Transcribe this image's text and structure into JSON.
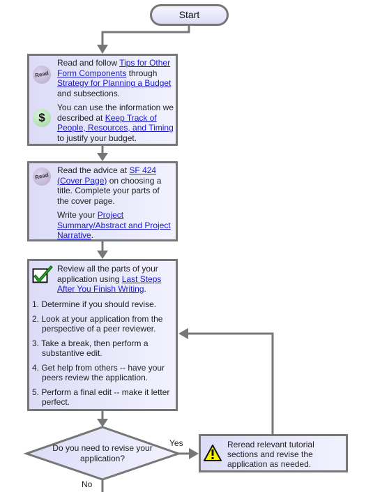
{
  "start": {
    "label": "Start"
  },
  "box1": {
    "read_icon": "Read",
    "p1": {
      "pre": "Read and follow ",
      "link1": "Tips for Other Form Components",
      "mid": " through ",
      "link2": "Strategy for Planning a Budget",
      "post": " and subsections."
    },
    "dollar_icon": "$",
    "p2": {
      "pre": "You can use the information we described at ",
      "link": "Keep Track of People, Resources, and Timing",
      "post": " to justify your budget."
    }
  },
  "box2": {
    "read_icon": "Read",
    "p1": {
      "pre": "Read the advice at ",
      "link": "SF 424 (Cover Page)",
      "post": " on choosing a title. Complete your parts of the cover page."
    },
    "p2": {
      "pre": "Write your ",
      "link": "Project Summary/Abstract and Project Narrative",
      "post": "."
    }
  },
  "box3": {
    "icon": "checkmark-icon",
    "intro": {
      "pre": "Review all the parts of your application using ",
      "link": "Last Steps After You Finish Writing",
      "post": "."
    },
    "steps": [
      "1. Determine if you should revise.",
      "2. Look at your application from the perspective of a peer reviewer.",
      "3. Take a break, then perform a substantive edit.",
      "4. Get help from others -- have your peers review the application.",
      "5. Perform a final edit -- make it letter perfect."
    ]
  },
  "decision": {
    "text": "Do you need to revise your application?",
    "yes": "Yes",
    "no": "No"
  },
  "box4": {
    "icon": "warning-icon",
    "text": "Reread relevant tutorial sections and revise the application as needed."
  },
  "colors": {
    "border": "#777777",
    "fill": "#e4e4fa",
    "link": "#1a1acc",
    "warning": "#f5f500"
  }
}
